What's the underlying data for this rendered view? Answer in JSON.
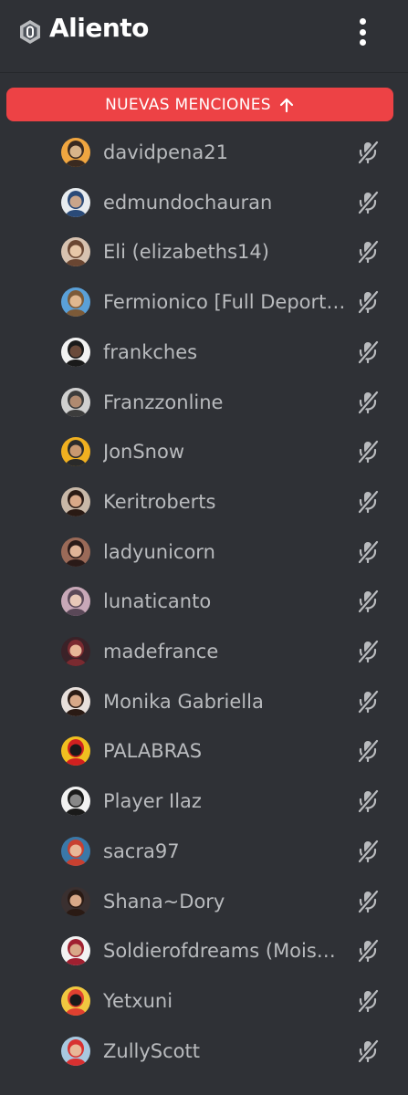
{
  "header": {
    "server_name": "Aliento",
    "server_icon": "server-badge-icon",
    "menu_icon": "kebab-menu-icon"
  },
  "banner": {
    "label": "NUEVAS MENCIONES",
    "icon": "arrow-up-icon",
    "color": "#ed4245"
  },
  "members": [
    {
      "name": "davidpena21",
      "avatar": [
        "#f0a640",
        "#3a2a20",
        "#d8b48a"
      ],
      "muted": true
    },
    {
      "name": "edmundochauran",
      "avatar": [
        "#e8ecef",
        "#2a4a78",
        "#c9a58a"
      ],
      "muted": true
    },
    {
      "name": "Eli (elizabeths14)",
      "avatar": [
        "#d7c2b0",
        "#6a4632",
        "#e7c7a8"
      ],
      "muted": true
    },
    {
      "name": "Fermionico [Full Deport…",
      "avatar": [
        "#5aa0d8",
        "#7c5a38",
        "#e0b890"
      ],
      "muted": true
    },
    {
      "name": "frankches",
      "avatar": [
        "#f2f2f2",
        "#1a1a1a",
        "#6a4a3a"
      ],
      "muted": true
    },
    {
      "name": "Franzzonline",
      "avatar": [
        "#d0d0d0",
        "#3c3c3c",
        "#b08a70"
      ],
      "muted": true
    },
    {
      "name": "JonSnow",
      "avatar": [
        "#f0b020",
        "#2a2a2a",
        "#c89870"
      ],
      "muted": true
    },
    {
      "name": "Keritroberts",
      "avatar": [
        "#c8b8a8",
        "#2a1a14",
        "#d8a888"
      ],
      "muted": true
    },
    {
      "name": "ladyunicorn",
      "avatar": [
        "#9a6a58",
        "#2a1a18",
        "#e0b498"
      ],
      "muted": true
    },
    {
      "name": "lunaticanto",
      "avatar": [
        "#c8a8b8",
        "#5a4858",
        "#e8c8b8"
      ],
      "muted": true
    },
    {
      "name": "madefrance",
      "avatar": [
        "#3a2228",
        "#7a2a30",
        "#e8b898"
      ],
      "muted": true
    },
    {
      "name": "Monika Gabriella",
      "avatar": [
        "#e8e0dc",
        "#2a1a14",
        "#d8a888"
      ],
      "muted": true
    },
    {
      "name": "PALABRAS",
      "avatar": [
        "#f0c020",
        "#d02020",
        "#1a1a1a"
      ],
      "muted": true
    },
    {
      "name": "Player Ilaz",
      "avatar": [
        "#f2f2f2",
        "#1a1a1a",
        "#888888"
      ],
      "muted": true
    },
    {
      "name": "sacra97",
      "avatar": [
        "#3a78a8",
        "#c84030",
        "#e8b898"
      ],
      "muted": true
    },
    {
      "name": "Shana~Dory",
      "avatar": [
        "#3a3030",
        "#2a1a14",
        "#d8a888"
      ],
      "muted": true
    },
    {
      "name": "Soldierofdreams (Mois…",
      "avatar": [
        "#f2f2f2",
        "#a02030",
        "#d8a888"
      ],
      "muted": true
    },
    {
      "name": "Yetxuni",
      "avatar": [
        "#f0c840",
        "#e04030",
        "#1a1a1a"
      ],
      "muted": true
    },
    {
      "name": "ZullyScott",
      "avatar": [
        "#a8c8e0",
        "#d83030",
        "#e8b898"
      ],
      "muted": true
    }
  ],
  "colors": {
    "background": "#2f3136",
    "member_text": "#b9bbbe",
    "mute_icon": "#b9bbbe"
  }
}
